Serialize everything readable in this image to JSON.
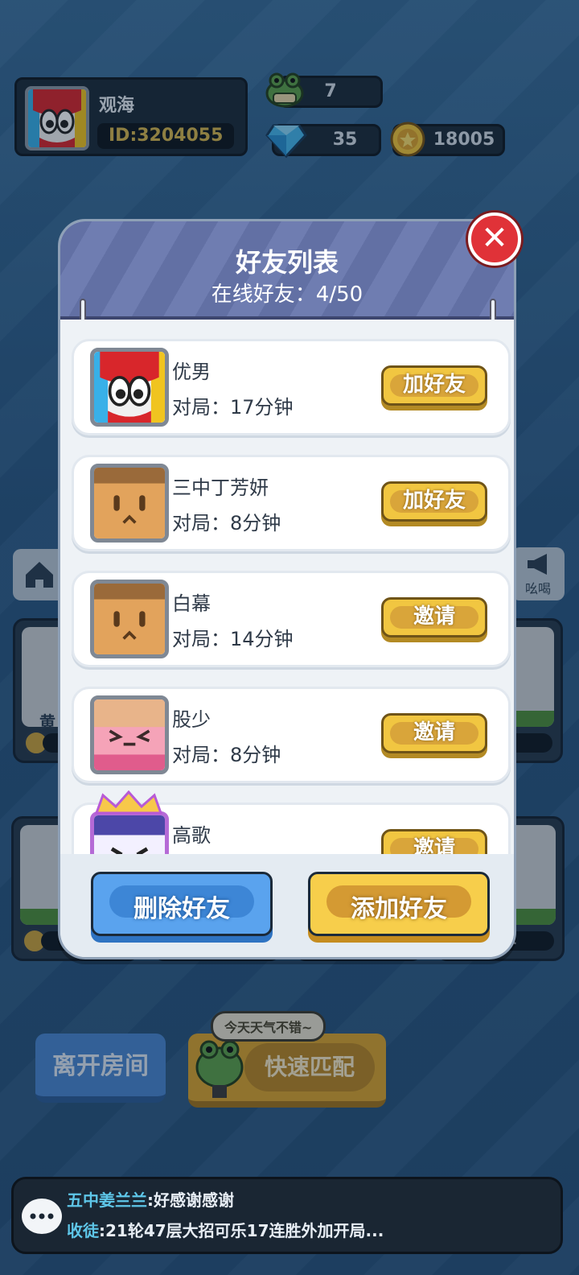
{
  "player": {
    "name": "观海",
    "id": "ID:3204055"
  },
  "resources": {
    "tickets": "7",
    "diamonds": "35",
    "coins": "18005"
  },
  "room": {
    "slots": [
      {
        "name": "黄",
        "status": "..."
      },
      {
        "name": "",
        "status": "..."
      },
      {
        "name": "",
        "status": "..."
      },
      {
        "name": "",
        "status": "..."
      },
      {
        "name": "",
        "status": "..."
      },
      {
        "name": "",
        "status": "..."
      },
      {
        "name": "",
        "status": "..."
      },
      {
        "name": "",
        "status": "..."
      }
    ],
    "speak_label": "吆喝",
    "leave_label": "离开房间",
    "match_label": "快速匹配",
    "bubble_text": "今天天气不错~"
  },
  "chat": [
    {
      "who": "五中姜兰兰",
      "msg": ":好感谢感谢"
    },
    {
      "who": "收徒",
      "msg": ":21轮47层大招可乐17连胜外加开局..."
    }
  ],
  "modal": {
    "title": "好友列表",
    "subtitle": "在线好友：4/50",
    "close_label": "✕",
    "friends": [
      {
        "name": "优男",
        "time": "对局：17分钟",
        "action": "加好友"
      },
      {
        "name": "三中丁芳妍",
        "time": "对局：8分钟",
        "action": "加好友"
      },
      {
        "name": "白幕",
        "time": "对局：14分钟",
        "action": "邀请"
      },
      {
        "name": "股少",
        "time": "对局：8分钟",
        "action": "邀请"
      },
      {
        "name": "高歌",
        "time": "",
        "action": "邀请"
      }
    ],
    "delete_label": "删除好友",
    "add_label": "添加好友"
  },
  "colors": {
    "accent_gold": "#f1c641",
    "accent_blue": "#5aa3ee",
    "close_red": "#e03238",
    "header_purple": "#6270a4"
  }
}
